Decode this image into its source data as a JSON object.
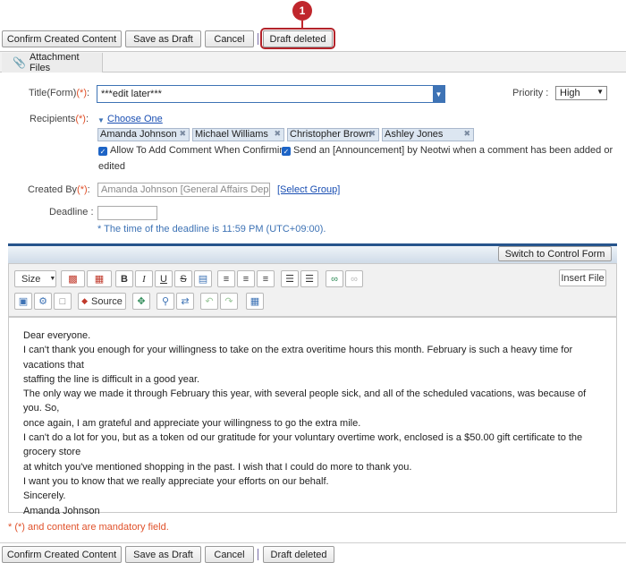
{
  "top_actions": {
    "confirm": "Confirm Created Content",
    "save_draft": "Save as Draft",
    "cancel": "Cancel",
    "draft_deleted": "Draft deleted"
  },
  "callout_number": "1",
  "tab": {
    "label": "Attachment Files"
  },
  "form": {
    "title_label": "Title(Form)",
    "required_mark": "(*)",
    "title_value": "***edit later***",
    "priority_label": "Priority",
    "priority_value": "High",
    "recipients_label": "Recipients",
    "choose_one": "Choose One",
    "recipients": [
      "Amanda Johnson",
      "Michael Williams",
      "Christopher Brown",
      "Ashley Jones"
    ],
    "allow_comment": "Allow To Add Comment When Confirming",
    "send_announcement_1": "Send an [Announcement] by Neotwi when a comment has been added or",
    "send_announcement_2": "edited",
    "created_by_label": "Created By",
    "created_by_value": "Amanda Johnson [General Affairs Depa...",
    "select_group": "[Select Group]",
    "deadline_label": "Deadline",
    "deadline_note": "* The time of the deadline is 11:59 PM (UTC+09:00).",
    "colon": ":"
  },
  "editor": {
    "switch_button": "Switch to Control Form",
    "size_label": "Size",
    "source_label": "Source",
    "insert_file": "Insert File",
    "body_lines": [
      "Dear everyone.",
      "I can't thank you enough for your willingness to take on the extra overitime hours this month. February is such a heavy time for vacations that",
      "staffing the line is difficult in a good year.",
      "The only way we made it through February this year, with several people sick, and all of the scheduled vacations, was because of you. So,",
      "once again, I am grateful and appreciate your willingness to go the extra mile.",
      "I can't do a lot for you, but as a token od our gratitude for your voluntary overtime work, enclosed is a $50.00 gift certificate to the grocery store",
      "at  whitch you've mentioned shopping in the past. I wish that I could do more to thank you.",
      "I want you to know that we really appreciate your efforts on our behalf.",
      "Sincerely.",
      "Amanda Johnson"
    ]
  },
  "footer_note": "* (*) and content are mandatory field.",
  "bottom_actions": {
    "confirm": "Confirm Created Content",
    "save_draft": "Save as Draft",
    "cancel": "Cancel",
    "draft_deleted": "Draft deleted"
  },
  "colors": {
    "accent": "#3e73b5",
    "required": "#e0512a",
    "callout": "#c0262c",
    "editor_bar": "#26548c"
  }
}
